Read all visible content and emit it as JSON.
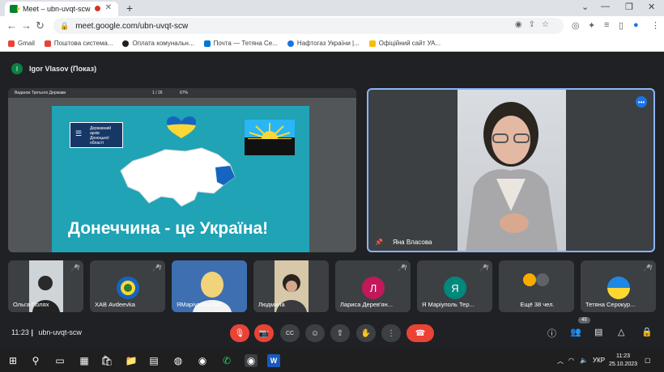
{
  "browser": {
    "tab_title": "Meet – ubn-uvqt-scw",
    "new_tab": "+",
    "url": "meet.google.com/ubn-uvqt-scw",
    "bookmarks": [
      {
        "label": "Gmail",
        "color": "#ea4335"
      },
      {
        "label": "Поштова система...",
        "color": "#ea4335"
      },
      {
        "label": "Оплата комунальн...",
        "color": "#202124"
      },
      {
        "label": "Почта — Тетяна Се...",
        "color": "#0078d4"
      },
      {
        "label": "Нафтогаз України |...",
        "color": "#1a73e8"
      },
      {
        "label": "Офіційний сайт УА...",
        "color": "#fbbc04"
      }
    ]
  },
  "meet": {
    "presenter_initial": "I",
    "presenter_label": "Igor Vlasov (Показ)",
    "slide": {
      "logo_text": "Державний архів Донецької області",
      "slogan": "Донеччина - це Україна!"
    },
    "pdf_toolbar": "Виданок Третього Держави",
    "pdf_page": "1 / 26",
    "pdf_zoom": "67%",
    "main_speaker": "Яна Власова",
    "participants": [
      {
        "name": "Ольга Полях",
        "initial": "",
        "color": ""
      },
      {
        "name": "ХАВ Avdeevka",
        "initial": "",
        "color": ""
      },
      {
        "name": "ЯМаріуполь Киї...",
        "initial": "",
        "color": ""
      },
      {
        "name": "Людмила",
        "initial": "",
        "color": ""
      },
      {
        "name": "Лариса Дерев'ян...",
        "initial": "Л",
        "color": "#c2185b"
      },
      {
        "name": "Я Маріуполь Тер...",
        "initial": "Я",
        "color": "#00897b"
      },
      {
        "name": "Ещё 38 чел.",
        "initial": "",
        "color": ""
      },
      {
        "name": "Тетяна Серокур...",
        "initial": "",
        "color": ""
      }
    ],
    "time": "11:23",
    "code": "ubn-uvqt-scw",
    "participant_count": "45"
  },
  "taskbar": {
    "lang": "УКР",
    "time": "11:23",
    "date": "25.10.2023"
  }
}
